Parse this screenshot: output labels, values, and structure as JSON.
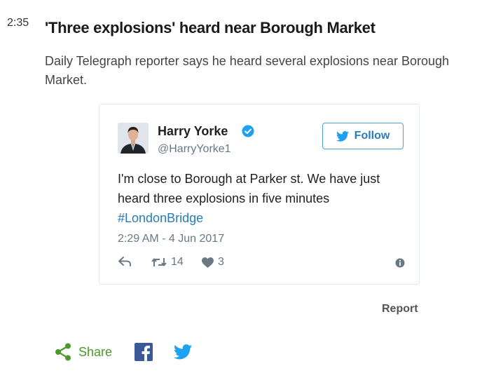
{
  "post": {
    "time": "2:35",
    "headline": "'Three explosions' heard near Borough Market",
    "summary": "Daily Telegraph reporter says he heard several explosions near Borough Market."
  },
  "tweet": {
    "author_name": "Harry Yorke",
    "handle": "@HarryYorke1",
    "follow_label": "Follow",
    "text": "I'm close to Borough at Parker st. We have just heard three explosions in five minutes",
    "hashtag": "#LondonBridge",
    "date": "2:29 AM - 4 Jun 2017",
    "retweets": "14",
    "likes": "3"
  },
  "report_label": "Report",
  "share": {
    "label": "Share"
  },
  "colors": {
    "twitter_blue": "#1da1f2",
    "link_blue": "#2b7bb9",
    "share_green": "#4c9a2a",
    "facebook": "#3b5998"
  }
}
